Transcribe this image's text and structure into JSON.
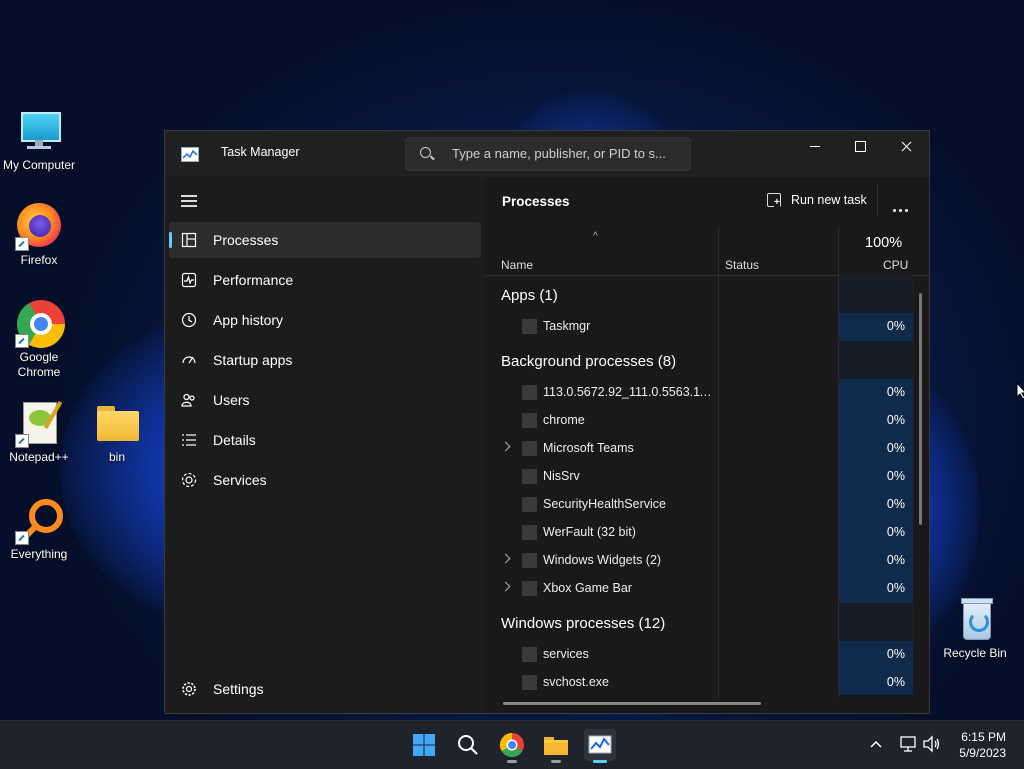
{
  "desktop": {
    "icons": [
      {
        "label": "My Computer"
      },
      {
        "label": "Firefox"
      },
      {
        "label": "Google Chrome"
      },
      {
        "label": "Notepad++"
      },
      {
        "label": "bin"
      },
      {
        "label": "Everything"
      },
      {
        "label": "Recycle Bin"
      }
    ]
  },
  "window": {
    "title": "Task Manager",
    "search_placeholder": "Type a name, publisher, or PID to s..."
  },
  "nav": {
    "items": [
      {
        "label": "Processes",
        "icon": "processes-icon"
      },
      {
        "label": "Performance",
        "icon": "performance-icon"
      },
      {
        "label": "App history",
        "icon": "app-history-icon"
      },
      {
        "label": "Startup apps",
        "icon": "startup-apps-icon"
      },
      {
        "label": "Users",
        "icon": "users-icon"
      },
      {
        "label": "Details",
        "icon": "details-icon"
      },
      {
        "label": "Services",
        "icon": "services-icon"
      }
    ],
    "settings_label": "Settings"
  },
  "main": {
    "title": "Processes",
    "run_new_task": "Run new task",
    "columns": {
      "name": "Name",
      "status": "Status",
      "cpu_total": "100%",
      "cpu": "CPU"
    },
    "groups": [
      {
        "title": "Apps (1)",
        "rows": [
          {
            "name": "Taskmgr",
            "cpu": "0%",
            "expandable": false
          }
        ]
      },
      {
        "title": "Background processes (8)",
        "rows": [
          {
            "name": "113.0.5672.92_111.0.5563.111_c...",
            "cpu": "0%",
            "expandable": false
          },
          {
            "name": "chrome",
            "cpu": "0%",
            "expandable": false
          },
          {
            "name": "Microsoft Teams",
            "cpu": "0%",
            "expandable": true
          },
          {
            "name": "NisSrv",
            "cpu": "0%",
            "expandable": false
          },
          {
            "name": "SecurityHealthService",
            "cpu": "0%",
            "expandable": false
          },
          {
            "name": "WerFault (32 bit)",
            "cpu": "0%",
            "expandable": false
          },
          {
            "name": "Windows Widgets (2)",
            "cpu": "0%",
            "expandable": true
          },
          {
            "name": "Xbox Game Bar",
            "cpu": "0%",
            "expandable": true
          }
        ]
      },
      {
        "title": "Windows processes (12)",
        "rows": [
          {
            "name": "services",
            "cpu": "0%",
            "expandable": false
          },
          {
            "name": "svchost.exe",
            "cpu": "0%",
            "expandable": false
          }
        ]
      }
    ]
  },
  "taskbar": {
    "time": "6:15 PM",
    "date": "5/9/2023"
  },
  "colors": {
    "accent": "#60cdff",
    "cpu_cell": "#0f2a4b",
    "window_bg": "#1c1c1c"
  }
}
